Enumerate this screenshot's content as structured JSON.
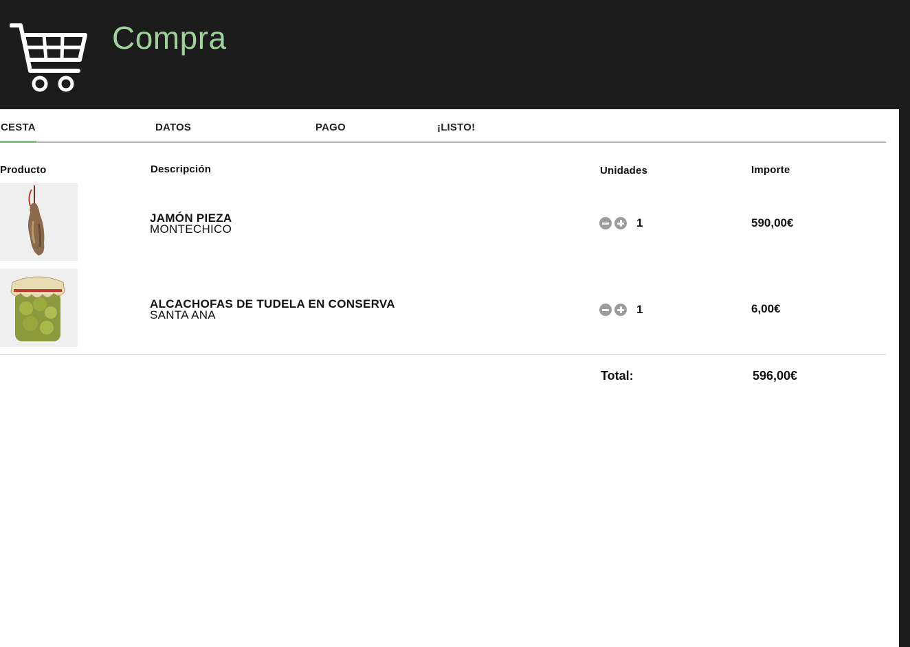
{
  "header": {
    "title": "Compra",
    "icon": "shopping-cart-icon",
    "background": "#1c1c1c",
    "title_color": "#9fd19a"
  },
  "tabs": [
    {
      "label": "CESTA",
      "active": true
    },
    {
      "label": "DATOS",
      "active": false
    },
    {
      "label": "PAGO",
      "active": false
    },
    {
      "label": "¡LISTO!",
      "active": false
    }
  ],
  "table": {
    "columns": {
      "product": "Producto",
      "description": "Descripción",
      "units": "Unidades",
      "amount": "Importe"
    },
    "rows": [
      {
        "image": "jamon-image",
        "name": "JAMÓN PIEZA",
        "brand": "MONTECHICO",
        "quantity": "1",
        "price": "590,00€"
      },
      {
        "image": "artichoke-jar-image",
        "name": "ALCACHOFAS DE TUDELA EN CONSERVA",
        "brand": "SANTA ANA",
        "quantity": "1",
        "price": "6,00€"
      }
    ],
    "total_label": "Total:",
    "total_value": "596,00€"
  },
  "colors": {
    "accent": "#7fbf79",
    "stepper": "#9c9c9c",
    "tab_line": "#b3b3b3"
  }
}
